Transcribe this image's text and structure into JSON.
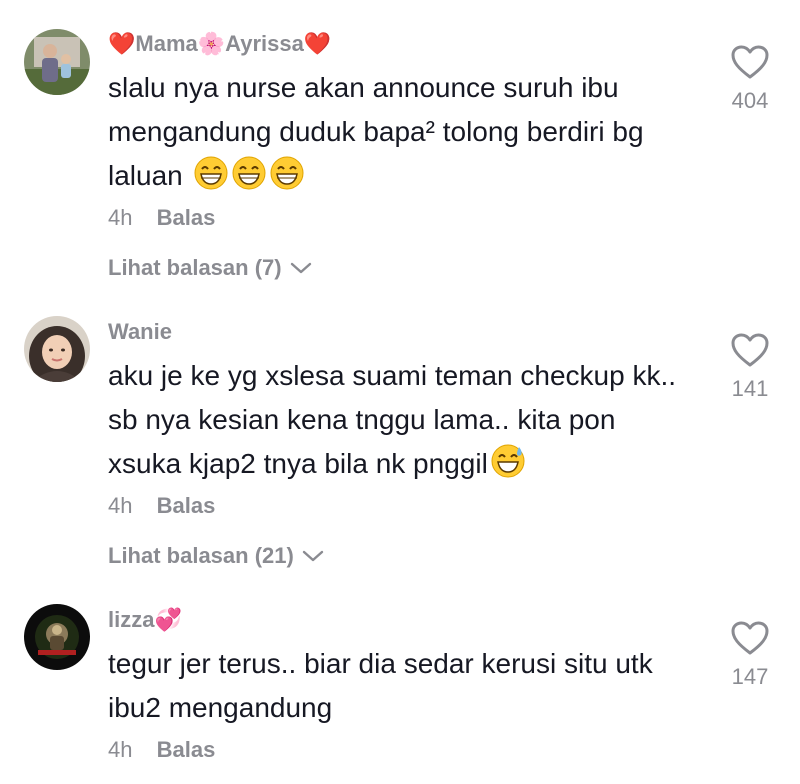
{
  "comments": [
    {
      "username": "❤️Mama🌸Ayrissa❤️",
      "text": "slalu nya nurse akan announce suruh ibu mengandung duduk bapa² tolong berdiri bg laluan",
      "time": "4h",
      "reply_label": "Balas",
      "view_replies": "Lihat balasan (7)",
      "likes": "404"
    },
    {
      "username": "Wanie",
      "text": "aku je ke yg xslesa suami teman checkup kk.. sb nya kesian kena tnggu lama.. kita pon xsuka kjap2 tnya bila nk pnggil",
      "time": "4h",
      "reply_label": "Balas",
      "view_replies": "Lihat balasan (21)",
      "likes": "141"
    },
    {
      "username": "lizza💞",
      "text": "tegur jer terus.. biar dia sedar kerusi situ utk ibu2 mengandung",
      "time": "4h",
      "reply_label": "Balas",
      "likes": "147"
    }
  ],
  "colors": {
    "text": "#161823",
    "muted": "#8a8b91",
    "background": "#ffffff"
  },
  "icons": [
    "heart-outline-icon",
    "chevron-down-icon",
    "grin-emoji-icon",
    "sweat-smile-emoji-icon"
  ]
}
